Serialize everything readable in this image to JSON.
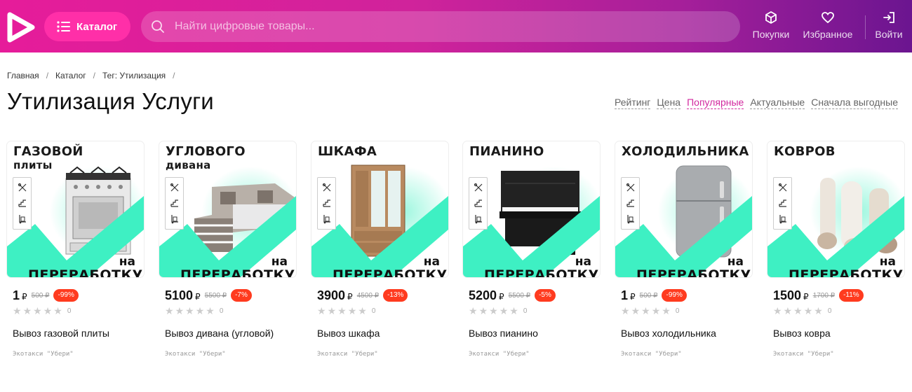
{
  "header": {
    "catalog_label": "Каталог",
    "search_placeholder": "Найти цифровые товары...",
    "purchases_label": "Покупки",
    "favorites_label": "Избранное",
    "login_label": "Войти",
    "brand_colors": {
      "gradient_start": "#e61c9a",
      "gradient_end": "#6b1590",
      "accent": "#ff2fa8"
    }
  },
  "breadcrumb": [
    "Главная",
    "Каталог",
    "Тег: Утилизация"
  ],
  "page_title": "Утилизация Услуги",
  "sort": {
    "options": [
      "Рейтинг",
      "Цена",
      "Популярные",
      "Актуальные",
      "Сначала выгодные"
    ],
    "active": "Популярные"
  },
  "products": [
    {
      "banner_top": "ГАЗОВОЙ",
      "banner_sub": "плиты",
      "banner_na": "на",
      "banner_bottom": "ПЕРЕРАБОТКУ",
      "price": "1",
      "currency": "₽",
      "old_price": "500 ₽",
      "discount": "-99%",
      "rating_count": "0",
      "name": "Вывоз газовой плиты",
      "seller": "Экотакси \"Убери\"",
      "item_icon": "gas-stove"
    },
    {
      "banner_top": "УГЛОВОГО",
      "banner_sub": "дивана",
      "banner_na": "на",
      "banner_bottom": "ПЕРЕРАБОТКУ",
      "price": "5100",
      "currency": "₽",
      "old_price": "5500 ₽",
      "discount": "-7%",
      "rating_count": "0",
      "name": "Вывоз дивана (угловой)",
      "seller": "Экотакси \"Убери\"",
      "item_icon": "sofa"
    },
    {
      "banner_top": "ШКАФА",
      "banner_sub": "",
      "banner_na": "на",
      "banner_bottom": "ПЕРЕРАБОТКУ",
      "price": "3900",
      "currency": "₽",
      "old_price": "4500 ₽",
      "discount": "-13%",
      "rating_count": "0",
      "name": "Вывоз шкафа",
      "seller": "Экотакси \"Убери\"",
      "item_icon": "wardrobe"
    },
    {
      "banner_top": "ПИАНИНО",
      "banner_sub": "",
      "banner_na": "на",
      "banner_bottom": "ПЕРЕРАБОТКУ",
      "price": "5200",
      "currency": "₽",
      "old_price": "5500 ₽",
      "discount": "-5%",
      "rating_count": "0",
      "name": "Вывоз пианино",
      "seller": "Экотакси \"Убери\"",
      "item_icon": "piano"
    },
    {
      "banner_top": "ХОЛОДИЛЬНИКА",
      "banner_sub": "",
      "banner_na": "на",
      "banner_bottom": "ПЕРЕРАБОТКУ",
      "price": "1",
      "currency": "₽",
      "old_price": "500 ₽",
      "discount": "-99%",
      "rating_count": "0",
      "name": "Вывоз холодильника",
      "seller": "Экотакси \"Убери\"",
      "item_icon": "fridge"
    },
    {
      "banner_top": "КОВРОВ",
      "banner_sub": "",
      "banner_na": "на",
      "banner_bottom": "ПЕРЕРАБОТКУ",
      "price": "1500",
      "currency": "₽",
      "old_price": "1700 ₽",
      "discount": "-11%",
      "rating_count": "0",
      "name": "Вывоз ковра",
      "seller": "Экотакси \"Убери\"",
      "item_icon": "rugs"
    }
  ]
}
